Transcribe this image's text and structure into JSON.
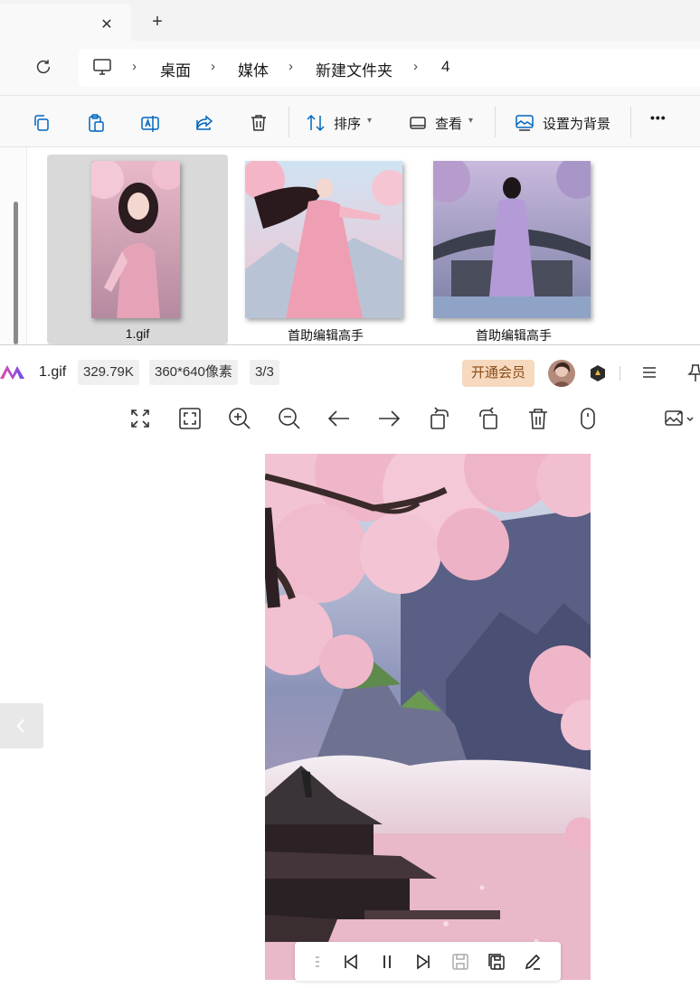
{
  "explorer": {
    "tab": {
      "close_glyph": "✕",
      "new_glyph": "+"
    },
    "breadcrumb": [
      "桌面",
      "媒体",
      "新建文件夹",
      "4"
    ],
    "breadcrumb_separator": "›",
    "toolbar": {
      "sort_label": "排序",
      "view_label": "查看",
      "set_background_label": "设置为背景",
      "more_label": "•••"
    },
    "files": [
      {
        "name": "1.gif",
        "selected": true
      },
      {
        "name": "首助编辑高手",
        "selected": false
      },
      {
        "name": "首助编辑高手",
        "selected": false
      }
    ]
  },
  "viewer": {
    "filename": "1.gif",
    "file_size": "329.79K",
    "dimensions": "360*640像素",
    "position": "3/3",
    "vip_label": "开通会员",
    "prev_glyph": "‹"
  },
  "colors": {
    "accent": "#0067c0",
    "vip_bg": "#f6d9bf",
    "vip_text": "#8a4b16",
    "selected_bg": "#d9d9d9"
  }
}
